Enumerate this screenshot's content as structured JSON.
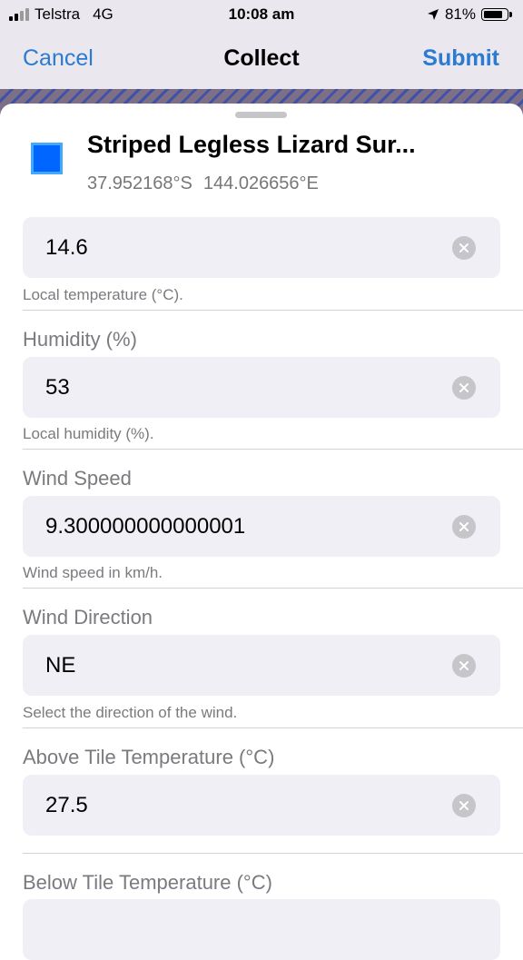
{
  "status_bar": {
    "carrier": "Telstra",
    "network": "4G",
    "time": "10:08 am",
    "battery": "81%"
  },
  "nav": {
    "cancel": "Cancel",
    "title": "Collect",
    "submit": "Submit"
  },
  "feature": {
    "title": "Striped Legless Lizard Sur...",
    "lat": "37.952168°S",
    "lon": "144.026656°E",
    "color": "#0066ff"
  },
  "fields": [
    {
      "label": "",
      "value": "14.6",
      "hint": "Local temperature (°C)."
    },
    {
      "label": "Humidity (%)",
      "value": "53",
      "hint": "Local humidity (%)."
    },
    {
      "label": "Wind Speed",
      "value": "9.300000000000001",
      "hint": "Wind speed in km/h."
    },
    {
      "label": "Wind Direction",
      "value": "NE",
      "hint": "Select the direction of the wind."
    },
    {
      "label": "Above Tile Temperature (°C)",
      "value": "27.5",
      "hint": ""
    },
    {
      "label": "Below Tile Temperature (°C)",
      "value": "",
      "hint": ""
    }
  ],
  "colors": {
    "accent": "#2b7bd2",
    "field_bg": "#f0eff5",
    "nav_bg": "#ebe7ee"
  }
}
